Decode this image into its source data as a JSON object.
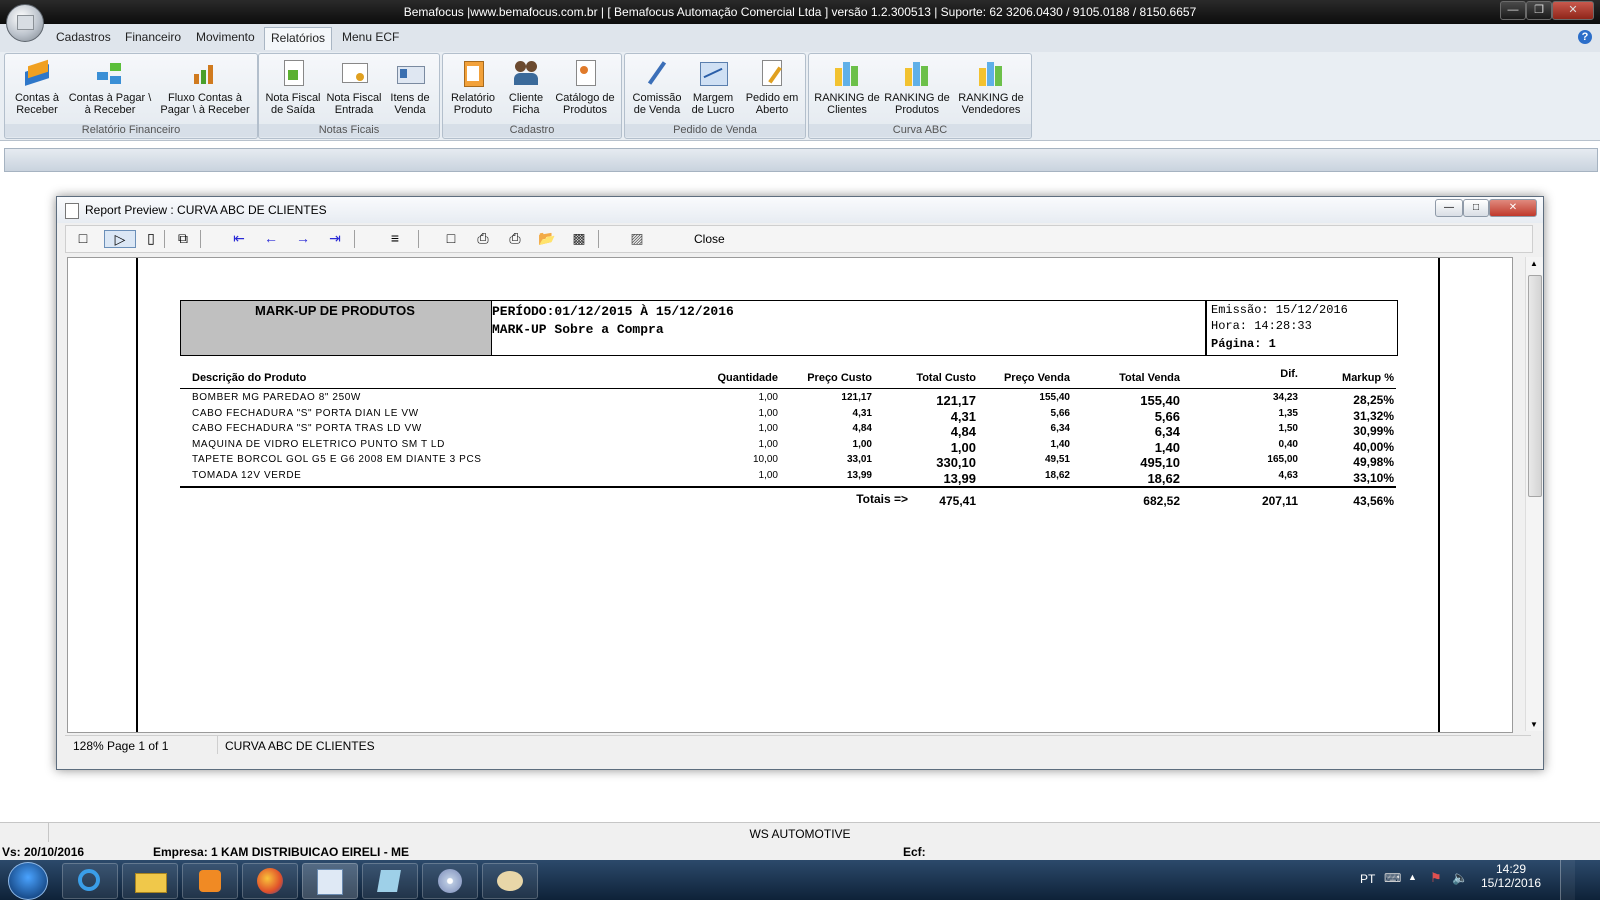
{
  "app": {
    "title": "Bemafocus |www.bemafocus.com.br | [ Bemafocus Automação Comercial Ltda ] versão 1.2.300513 | Suporte: 62 3206.0430 / 9105.0188 / 8150.6657"
  },
  "menu": {
    "tabs": [
      "Cadastros",
      "Financeiro",
      "Movimento",
      "Relatórios",
      "Menu ECF"
    ],
    "active": "Relatórios"
  },
  "ribbon": {
    "groups": [
      {
        "name": "Relatório Financeiro",
        "buttons": [
          [
            "Contas à",
            "Receber"
          ],
          [
            "Contas à Pagar \\",
            "à Receber"
          ],
          [
            "Fluxo Contas à",
            "Pagar \\ à Receber"
          ]
        ]
      },
      {
        "name": "Notas Ficais",
        "buttons": [
          [
            "Nota Fiscal",
            "de Saída"
          ],
          [
            "Nota Fiscal",
            "Entrada"
          ],
          [
            "Itens de",
            "Venda"
          ]
        ]
      },
      {
        "name": "Cadastro",
        "buttons": [
          [
            "Relatório",
            "Produto"
          ],
          [
            "Cliente",
            "Ficha"
          ],
          [
            "Catálogo de",
            "Produtos"
          ]
        ]
      },
      {
        "name": "Pedido de Venda",
        "buttons": [
          [
            "Comissão",
            "de Venda"
          ],
          [
            "Margem",
            "de Lucro"
          ],
          [
            "Pedido em",
            "Aberto"
          ]
        ]
      },
      {
        "name": "Curva ABC",
        "buttons": [
          [
            "RANKING de",
            "Clientes"
          ],
          [
            "RANKING de",
            "Produtos"
          ],
          [
            "RANKING  de",
            "Vendedores"
          ]
        ]
      }
    ]
  },
  "preview": {
    "title": "Report Preview : CURVA ABC DE CLIENTES",
    "close_label": "Close",
    "zoom": "128%",
    "page": "Page 1 of 1",
    "status_name": "CURVA ABC DE CLIENTES"
  },
  "report": {
    "title": "MARK-UP DE PRODUTOS",
    "period": "PERÍODO:01/12/2015 À 15/12/2016",
    "subtitle": "MARK-UP Sobre a Compra",
    "emissao": "Emissão: 15/12/2016",
    "hora": "Hora:    14:28:33",
    "pagina": "Página:  1",
    "columns": [
      "Descrição do Produto",
      "Quantidade",
      "Preço Custo",
      "Total Custo",
      "Preço Venda",
      "Total Venda",
      "Dif.",
      "Markup %"
    ],
    "rows": [
      [
        "BOMBER MG PAREDAO 8\" 250W",
        "1,00",
        "121,17",
        "121,17",
        "155,40",
        "155,40",
        "34,23",
        "28,25%"
      ],
      [
        "CABO FECHADURA \"S\" PORTA DIAN LE VW",
        "1,00",
        "4,31",
        "4,31",
        "5,66",
        "5,66",
        "1,35",
        "31,32%"
      ],
      [
        "CABO FECHADURA \"S\" PORTA TRAS LD VW",
        "1,00",
        "4,84",
        "4,84",
        "6,34",
        "6,34",
        "1,50",
        "30,99%"
      ],
      [
        "MAQUINA DE VIDRO ELETRICO PUNTO SM T LD",
        "1,00",
        "1,00",
        "1,00",
        "1,40",
        "1,40",
        "0,40",
        "40,00%"
      ],
      [
        "TAPETE BORCOL GOL G5 E G6 2008 EM DIANTE 3 PCS",
        "10,00",
        "33,01",
        "330,10",
        "49,51",
        "495,10",
        "165,00",
        "49,98%"
      ],
      [
        "TOMADA 12V VERDE",
        "1,00",
        "13,99",
        "13,99",
        "18,62",
        "18,62",
        "4,63",
        "33,10%"
      ]
    ],
    "totals_label": "Totais =>",
    "totals": {
      "total_custo": "475,41",
      "total_venda": "682,52",
      "dif": "207,11",
      "markup": "43,56%"
    }
  },
  "bottom": {
    "company_center": "WS AUTOMOTIVE",
    "version": "Vs: 20/10/2016",
    "empresa": "Empresa: 1 KAM DISTRIBUICAO EIRELI - ME",
    "ecf": "Ecf:"
  },
  "taskbar": {
    "lang": "PT",
    "time": "14:29",
    "date": "15/12/2016"
  }
}
